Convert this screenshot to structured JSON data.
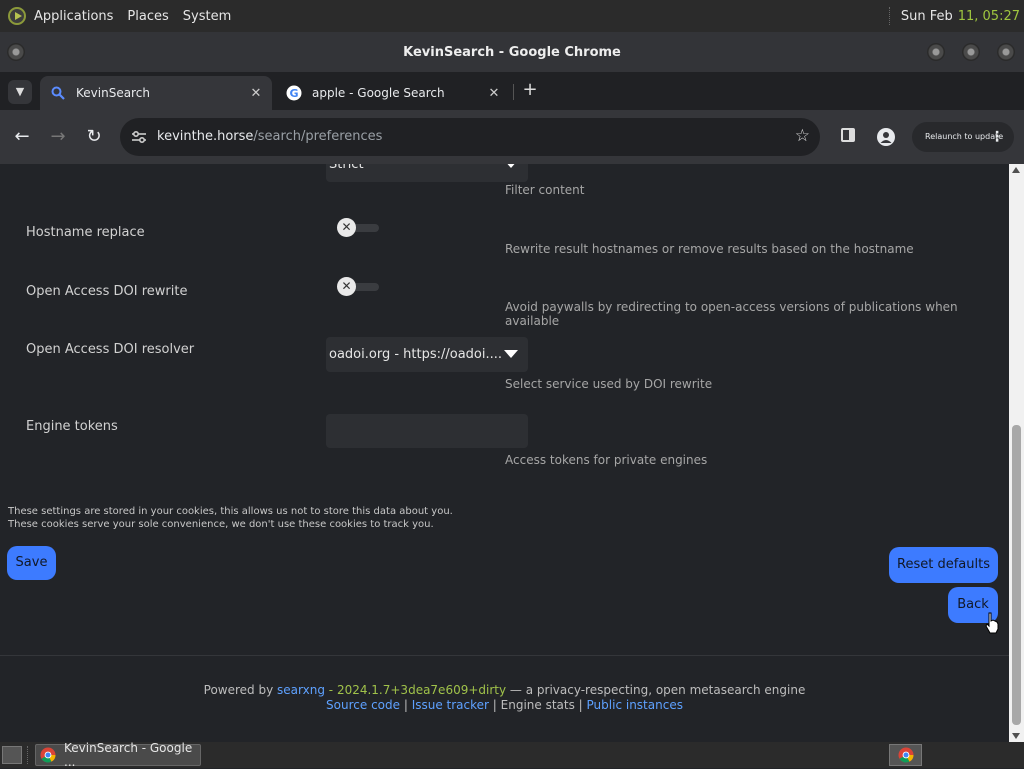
{
  "panel": {
    "menus": [
      "Applications",
      "Places",
      "System"
    ],
    "date": "Sun Feb",
    "time": "11, 05:27"
  },
  "window": {
    "title": "KevinSearch - Google Chrome"
  },
  "tabs": [
    {
      "label": "KevinSearch",
      "active": true,
      "icon": "search-icon"
    },
    {
      "label": "apple - Google Search",
      "active": false,
      "icon": "google-icon"
    }
  ],
  "toolbar": {
    "url_host": "kevinthe.horse",
    "url_path": "/search/preferences",
    "relaunch_label": "Relaunch to update"
  },
  "prefs": {
    "filter_value": "Strict",
    "filter_desc": "Filter content",
    "hostname_label": "Hostname replace",
    "hostname_desc": "Rewrite result hostnames or remove results based on the hostname",
    "doi_rewrite_label": "Open Access DOI rewrite",
    "doi_rewrite_desc": "Avoid paywalls by redirecting to open-access versions of publications when available",
    "doi_resolver_label": "Open Access DOI resolver",
    "doi_resolver_value": "oadoi.org - https://oadoi....",
    "doi_resolver_desc": "Select service used by DOI rewrite",
    "tokens_label": "Engine tokens",
    "tokens_desc": "Access tokens for private engines"
  },
  "cookie_note": {
    "line1": "These settings are stored in your cookies, this allows us not to store this data about you.",
    "line2": "These cookies serve your sole convenience, we don't use these cookies to track you."
  },
  "buttons": {
    "save": "Save",
    "reset": "Reset defaults",
    "back": "Back"
  },
  "footer": {
    "powered_by": "Powered by",
    "searxng": "searxng",
    "version": " - 2024.1.7+3dea7e609+dirty",
    "tagline": " — a privacy-respecting, open metasearch engine",
    "source": "Source code",
    "issues": "Issue tracker",
    "stats": "Engine stats",
    "instances": "Public instances",
    "divider": " | "
  },
  "taskbar": {
    "task_label": "KevinSearch - Google ..."
  }
}
